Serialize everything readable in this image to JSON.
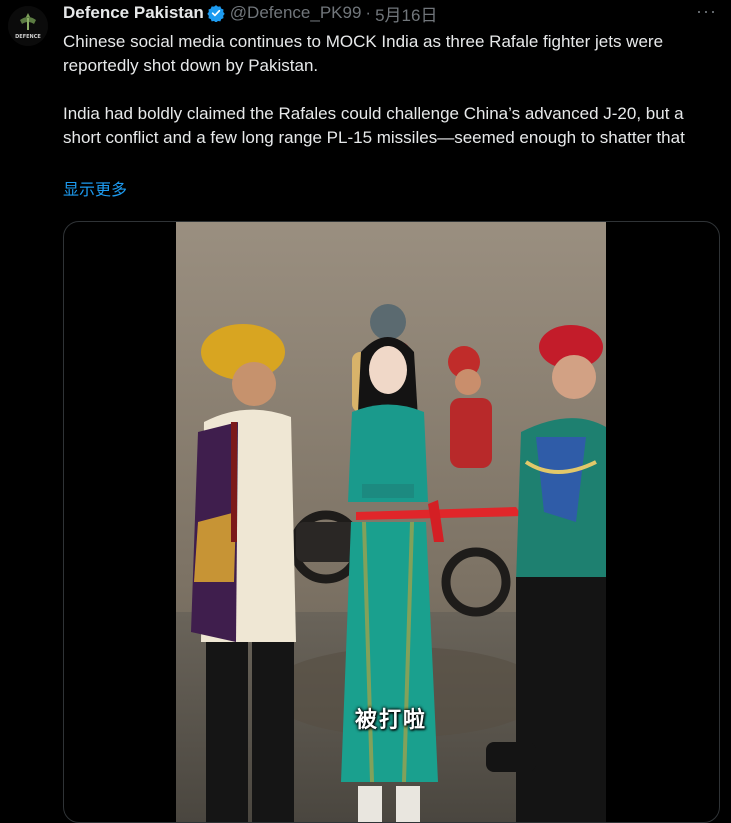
{
  "author": {
    "display_name": "Defence Pakistan",
    "handle": "@Defence_PK99",
    "separator": "·",
    "date": "5月16日",
    "avatar_text": "DEFENCE",
    "verified_icon": "verified-badge-icon"
  },
  "tweet": {
    "paragraph_1": "Chinese social media continues to MOCK India as three Rafale fighter jets were reportedly shot down by Pakistan.",
    "paragraph_2": "India had boldly claimed the Rafales could challenge China’s advanced J-20, but a short conflict and a few long range PL-15 missiles—seemed enough to shatter that",
    "show_more": "显示更多"
  },
  "media": {
    "subtitle": "被打啦"
  },
  "menu": {
    "more_icon": "more-dots-icon",
    "more_label": "···"
  },
  "colors": {
    "background": "#000000",
    "text": "#e7e9ea",
    "muted": "#71767b",
    "link": "#1d9bf0",
    "verified": "#1d9bf0"
  }
}
